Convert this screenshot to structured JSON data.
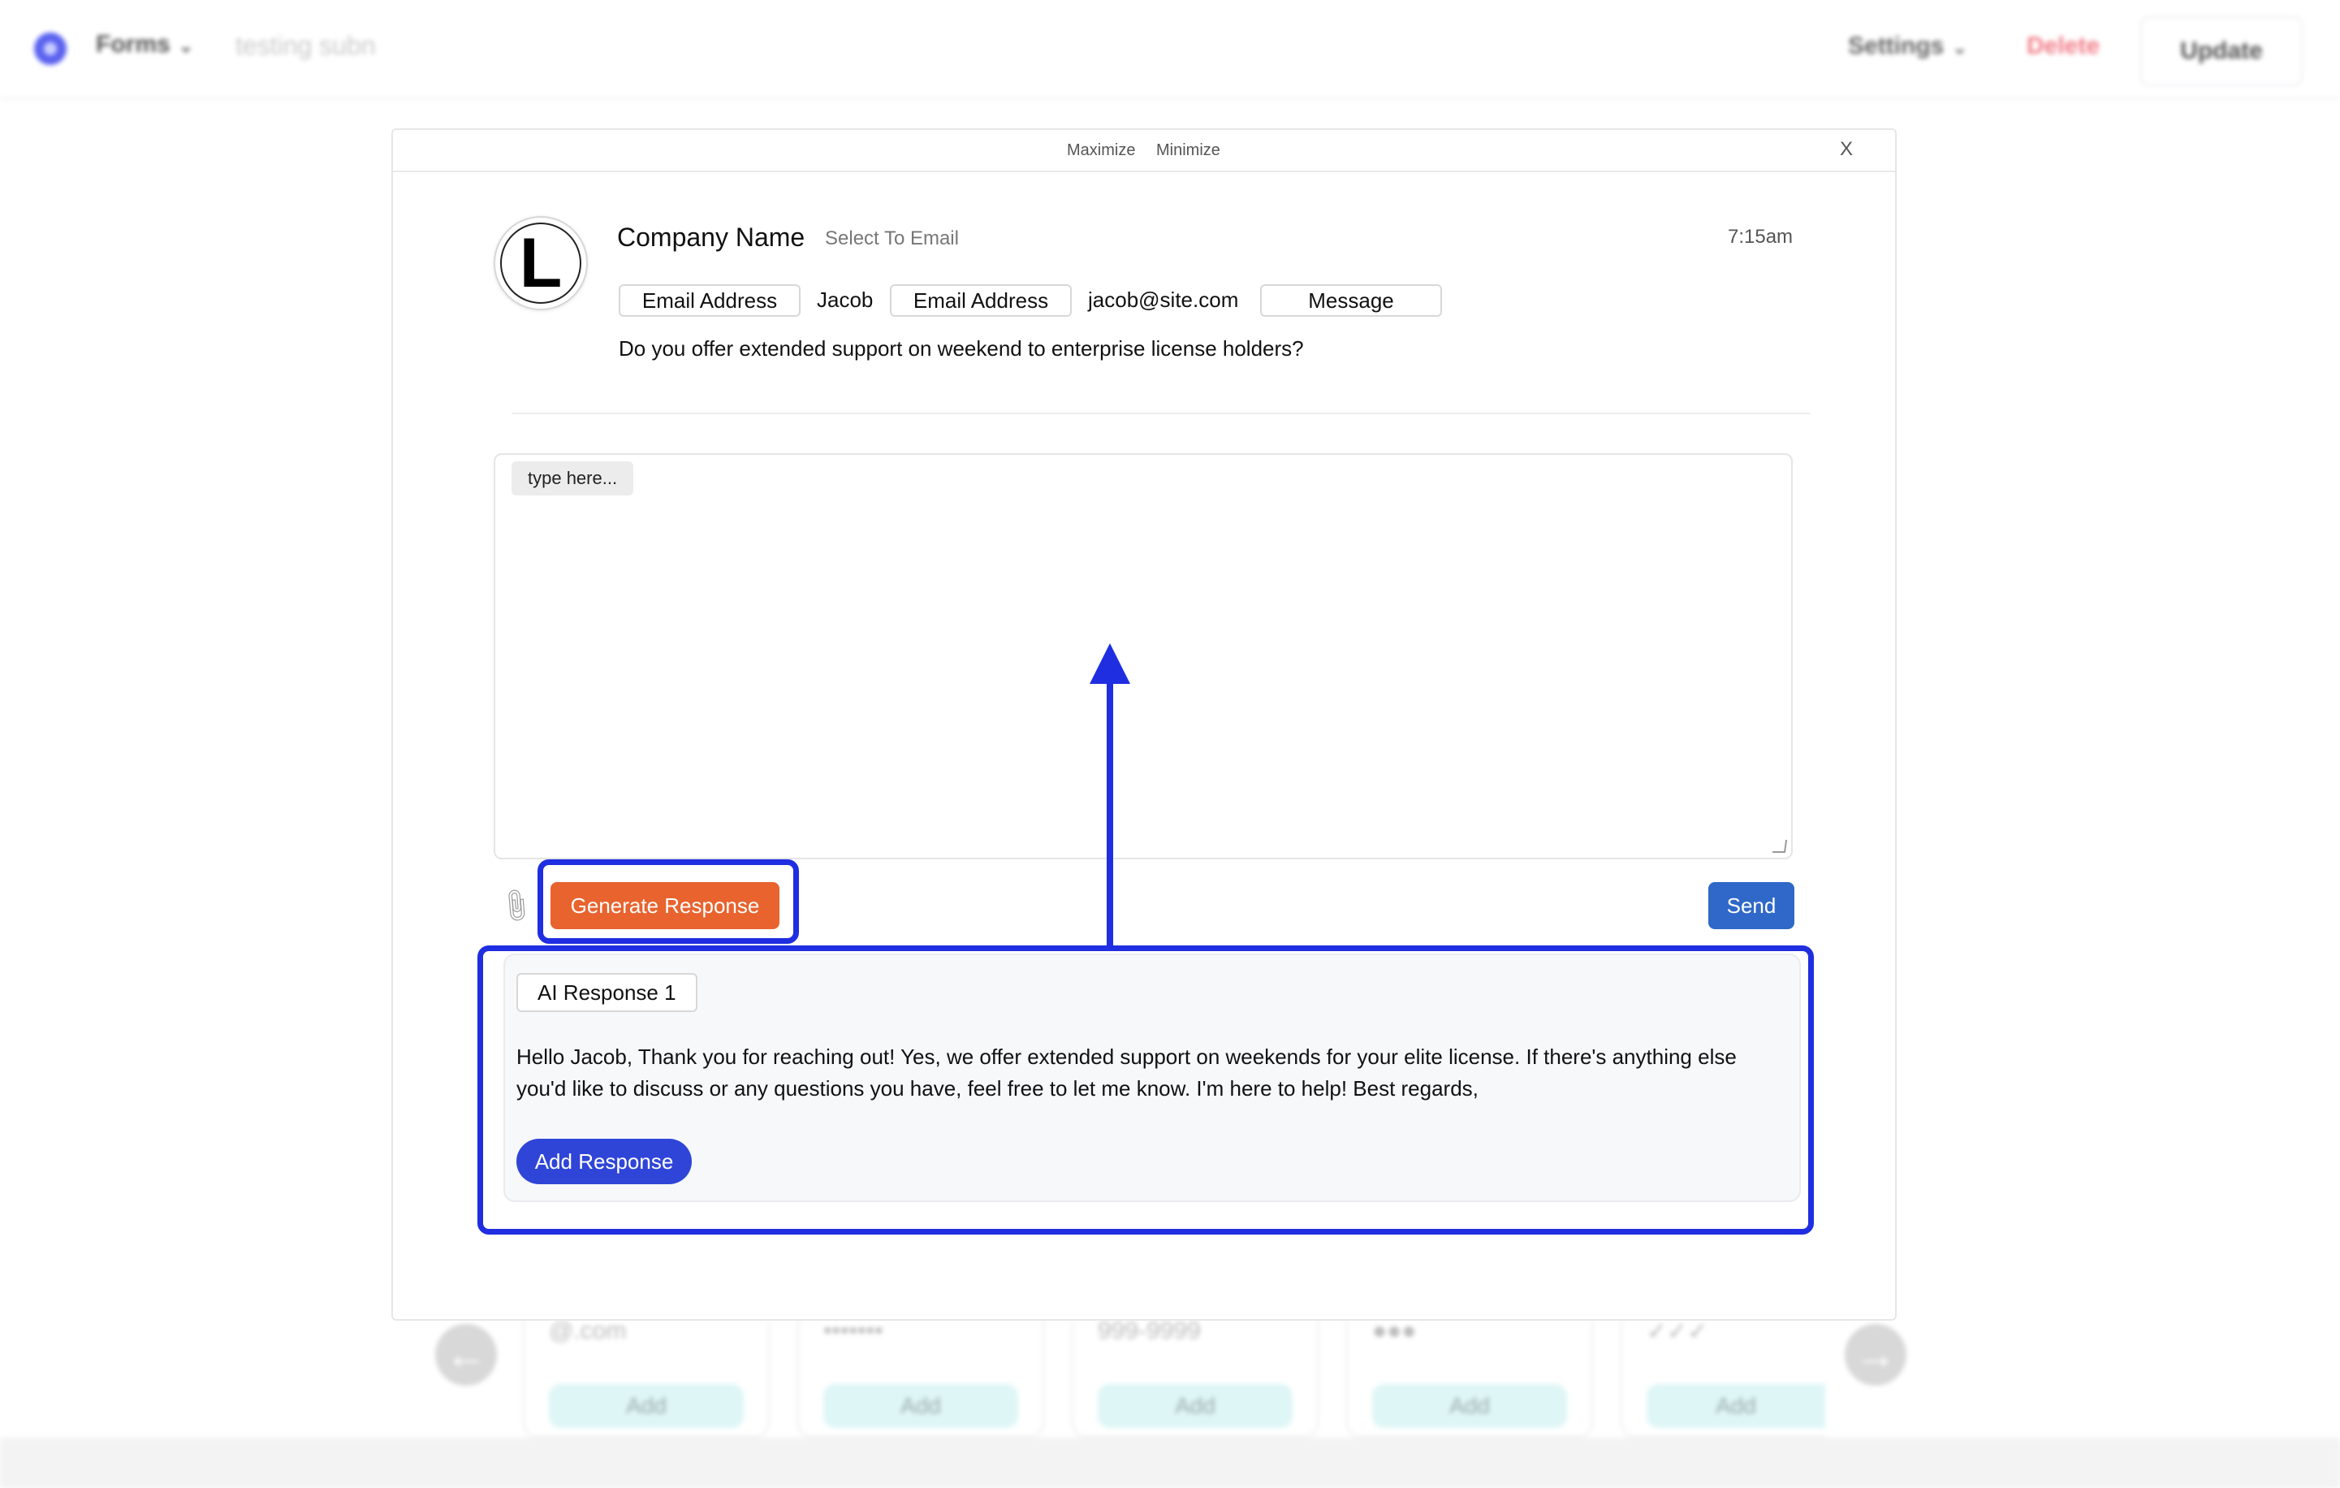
{
  "app": {
    "menu_forms": "Forms",
    "breadcrumb": "testing subn",
    "menu_settings": "Settings",
    "delete_label": "Delete",
    "update_label": "Update"
  },
  "modal": {
    "maximize": "Maximize",
    "minimize": "Minimize",
    "close": "X"
  },
  "email": {
    "avatar_letter": "L",
    "company_name": "Company Name",
    "select_to_email": "Select To Email",
    "time": "7:15am",
    "fields": {
      "tag1": "Email Address",
      "value1": "Jacob",
      "tag2": "Email Address",
      "value2": "jacob@site.com",
      "tag3": "Message"
    },
    "question": "Do you offer extended support on weekend to enterprise license holders?"
  },
  "composer": {
    "placeholder": "type here...",
    "generate_label": "Generate Response",
    "send_label": "Send"
  },
  "ai_response": {
    "tag": "AI Response 1",
    "text": "Hello Jacob, Thank you for reaching out! Yes, we offer extended support on weekends for your elite license. If there's anything else you'd like to discuss or any questions you have, feel free to let me know. I'm here to help! Best regards,",
    "add_label": "Add Response"
  },
  "background_cards": [
    {
      "sample": "@.com",
      "add": "Add"
    },
    {
      "sample": "•••••••",
      "add": "Add"
    },
    {
      "sample": "999-9999",
      "add": "Add"
    },
    {
      "sample": "●●●",
      "add": "Add"
    },
    {
      "sample": "✓✓✓",
      "add": "Add"
    }
  ],
  "colors": {
    "annotation": "#1f2ee0",
    "generate_button": "#e8632e",
    "send_button": "#2f68c8",
    "add_response_button": "#2f45d8"
  }
}
